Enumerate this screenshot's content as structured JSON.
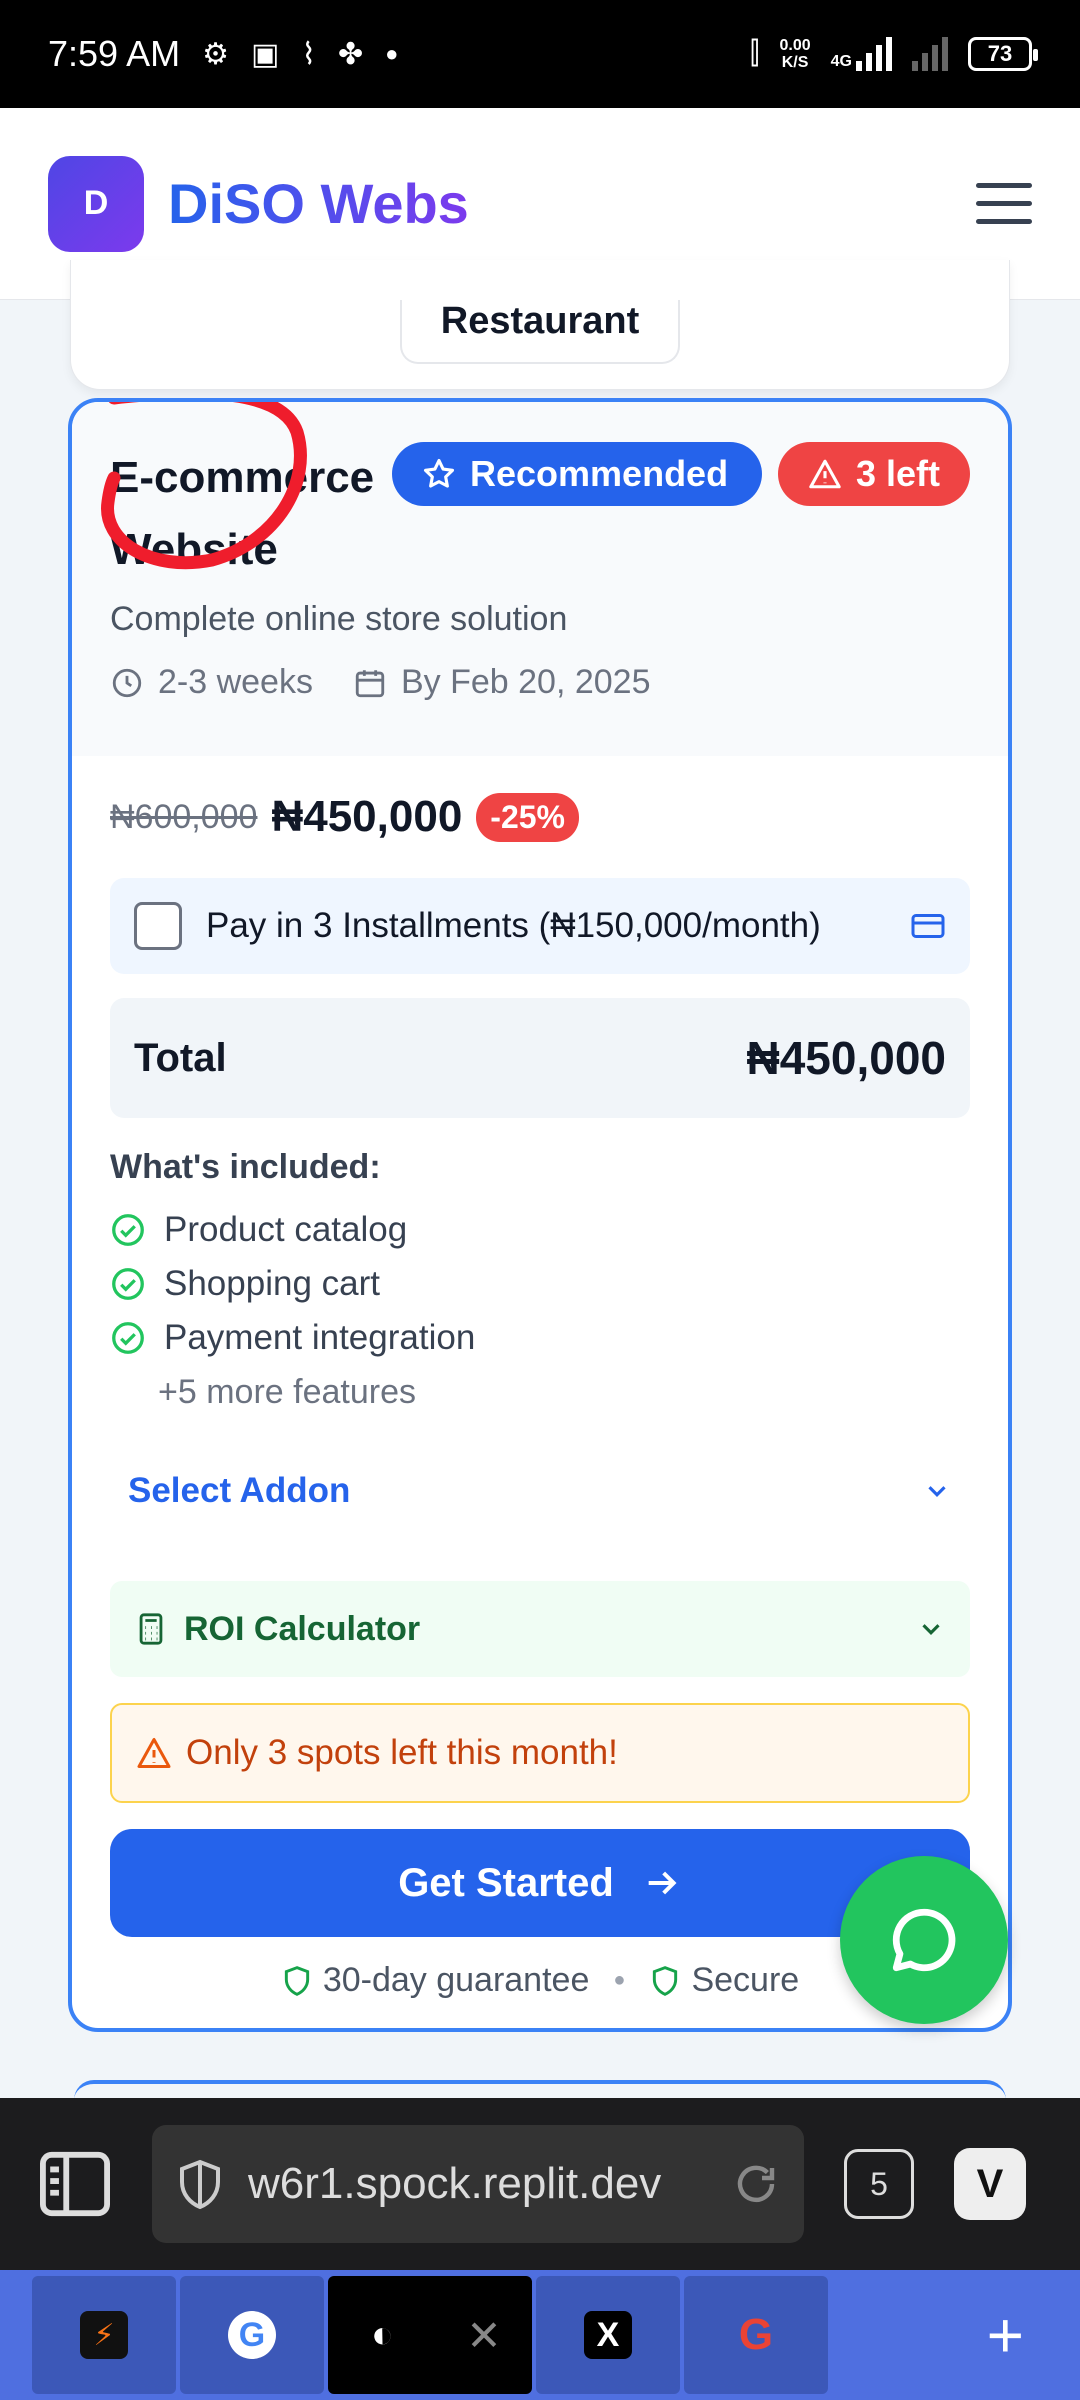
{
  "status_bar": {
    "time": "7:59 AM",
    "net_speed": "0.00",
    "net_unit": "K/S",
    "network": "4G",
    "battery": "73"
  },
  "header": {
    "logo_letter": "D",
    "brand": "DiSO Webs"
  },
  "previous_card": {
    "button_label": "Restaurant"
  },
  "card": {
    "title": "E-commerce Website",
    "badge_recommended": "Recommended",
    "badge_left": "3 left",
    "subtitle": "Complete online store solution",
    "duration": "2-3 weeks",
    "delivery": "By Feb 20, 2025",
    "price_old": "₦600,000",
    "price_new": "₦450,000",
    "discount": "-25%",
    "installments_label": "Pay in 3 Installments (₦150,000/month)",
    "installments_checked": false,
    "total_label": "Total",
    "total_value": "₦450,000",
    "included_heading": "What's included:",
    "features": [
      "Product catalog",
      "Shopping cart",
      "Payment integration"
    ],
    "more_features": "+5 more features",
    "addon_label": "Select Addon",
    "roi_label": "ROI Calculator",
    "warning": "Only 3 spots left this month!",
    "cta": "Get Started",
    "guarantee": "30-day guarantee",
    "secure": "Secure"
  },
  "browser": {
    "url": "w6r1.spock.replit.dev",
    "tab_count": "5"
  },
  "colors": {
    "primary": "#2563eb",
    "danger": "#ef4444",
    "success": "#22c55e",
    "brand_gradient_start": "#2563eb",
    "brand_gradient_end": "#7c3aed"
  }
}
